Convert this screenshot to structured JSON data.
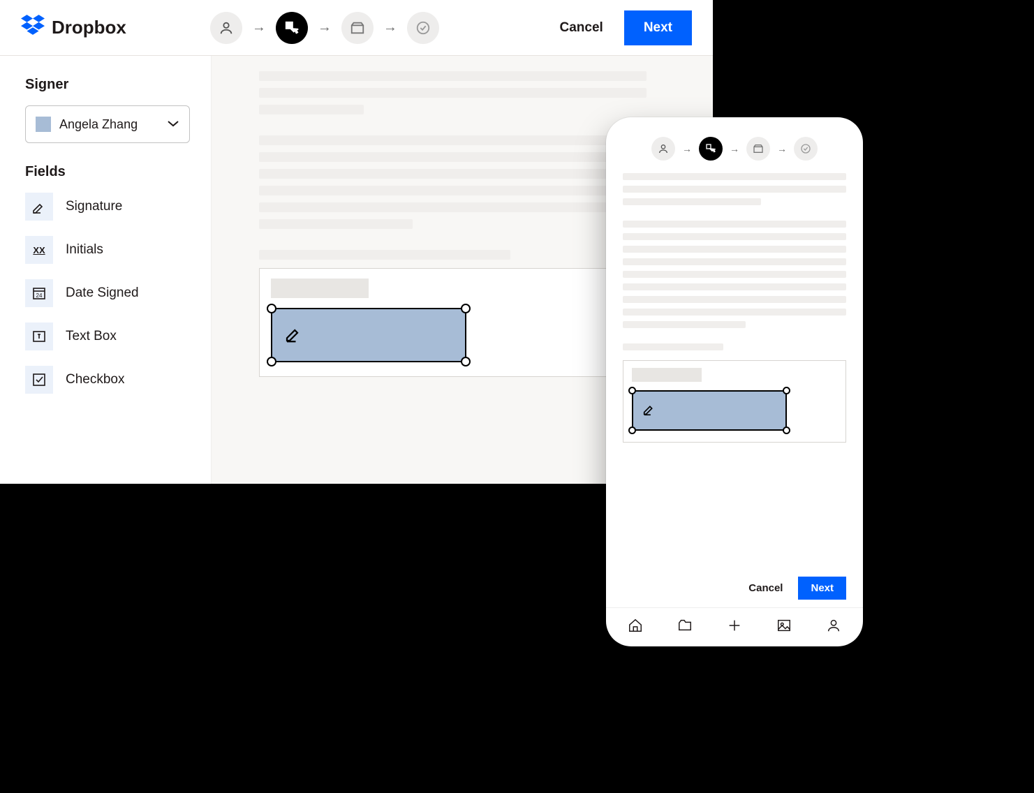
{
  "brand": {
    "name": "Dropbox"
  },
  "header": {
    "cancel_label": "Cancel",
    "next_label": "Next",
    "steps": [
      {
        "icon": "person-icon",
        "active": false
      },
      {
        "icon": "cursor-edit-icon",
        "active": true
      },
      {
        "icon": "folder-icon",
        "active": false
      },
      {
        "icon": "check-circle-icon",
        "active": false
      }
    ]
  },
  "sidebar": {
    "signer_heading": "Signer",
    "signer": {
      "name": "Angela Zhang",
      "color": "#a7bcd6"
    },
    "fields_heading": "Fields",
    "fields": [
      {
        "icon": "signature-icon",
        "label": "Signature"
      },
      {
        "icon": "initials-icon",
        "label": "Initials",
        "glyph": "XX"
      },
      {
        "icon": "date-icon",
        "label": "Date Signed",
        "glyph": "24"
      },
      {
        "icon": "textbox-icon",
        "label": "Text Box",
        "glyph": "I"
      },
      {
        "icon": "checkbox-icon",
        "label": "Checkbox"
      }
    ]
  },
  "document": {
    "selected_field_type": "Signature"
  },
  "mobile": {
    "cancel_label": "Cancel",
    "next_label": "Next",
    "tabs": [
      "home-icon",
      "folder-icon",
      "plus-icon",
      "image-icon",
      "person-icon"
    ]
  },
  "colors": {
    "primary": "#0061fe",
    "signer": "#a7bcd6",
    "field_bg": "#ebf1fa"
  }
}
